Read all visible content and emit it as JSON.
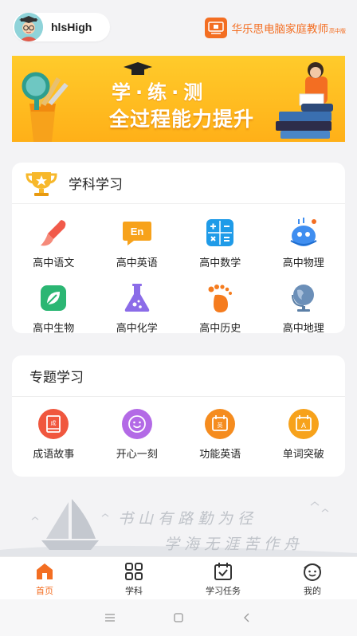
{
  "header": {
    "username": "hlsHigh",
    "brand_name": "华乐思电脑家庭教师",
    "brand_sub": "高中版"
  },
  "banner": {
    "title": "学·练·测",
    "subtitle": "全过程能力提升"
  },
  "subjects": {
    "title": "学科学习",
    "items": [
      {
        "label": "高中语文",
        "icon": "brush-icon",
        "color": "#f15a4a"
      },
      {
        "label": "高中英语",
        "icon": "english-bubble-icon",
        "color": "#f7a21b"
      },
      {
        "label": "高中数学",
        "icon": "calculator-icon",
        "color": "#1f9be8"
      },
      {
        "label": "高中物理",
        "icon": "atom-icon",
        "color": "#3f8ef0"
      },
      {
        "label": "高中生物",
        "icon": "leaf-icon",
        "color": "#2bb673"
      },
      {
        "label": "高中化学",
        "icon": "flask-icon",
        "color": "#8b6ce8"
      },
      {
        "label": "高中历史",
        "icon": "footprint-icon",
        "color": "#f57c1f"
      },
      {
        "label": "高中地理",
        "icon": "globe-icon",
        "color": "#5b7fa6"
      }
    ]
  },
  "topics": {
    "title": "专题学习",
    "items": [
      {
        "label": "成语故事",
        "icon": "book-icon",
        "color": "#f0573e"
      },
      {
        "label": "开心一刻",
        "icon": "smile-icon",
        "color": "#b36ae6"
      },
      {
        "label": "功能英语",
        "icon": "english-card-icon",
        "color": "#f58c1f"
      },
      {
        "label": "单词突破",
        "icon": "letter-card-icon",
        "color": "#f7a21b"
      }
    ]
  },
  "slogan": {
    "line1": "书山有路勤为径",
    "line2": "学海无涯苦作舟"
  },
  "tabbar": {
    "items": [
      {
        "label": "首页",
        "icon": "home-icon",
        "active": true
      },
      {
        "label": "学科",
        "icon": "grid-icon",
        "active": false
      },
      {
        "label": "学习任务",
        "icon": "calendar-check-icon",
        "active": false
      },
      {
        "label": "我的",
        "icon": "profile-face-icon",
        "active": false
      }
    ],
    "active_color": "#f36e22"
  },
  "sysnav": {
    "items": [
      "menu-icon",
      "home-square-icon",
      "back-icon"
    ]
  }
}
